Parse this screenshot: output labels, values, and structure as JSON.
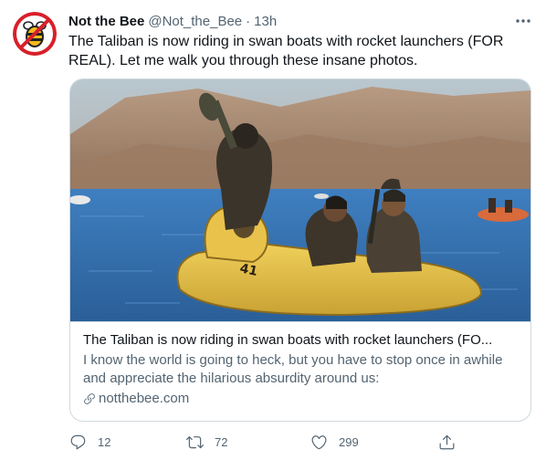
{
  "tweet": {
    "author_name": "Not the Bee",
    "author_handle": "@Not_the_Bee",
    "separator": "·",
    "time": "13h",
    "more_icon": "more-horizontal-icon",
    "text": "The Taliban is now riding in swan boats with rocket launchers (FOR REAL). Let me walk you through these insane photos."
  },
  "card": {
    "title": "The Taliban is now riding in swan boats with rocket launchers (FO...",
    "description": "I know the world is going to heck, but you have to stop once in awhile and appreciate the hilarious absurdity around us:",
    "domain": "notthebee.com",
    "boat_number": "41"
  },
  "actions": {
    "reply_count": "12",
    "retweet_count": "72",
    "like_count": "299"
  },
  "colors": {
    "text_primary": "#0f1419",
    "text_secondary": "#536471",
    "border": "#cfd9de",
    "logo_red": "#d8202a",
    "logo_yellow": "#f5b81c"
  }
}
